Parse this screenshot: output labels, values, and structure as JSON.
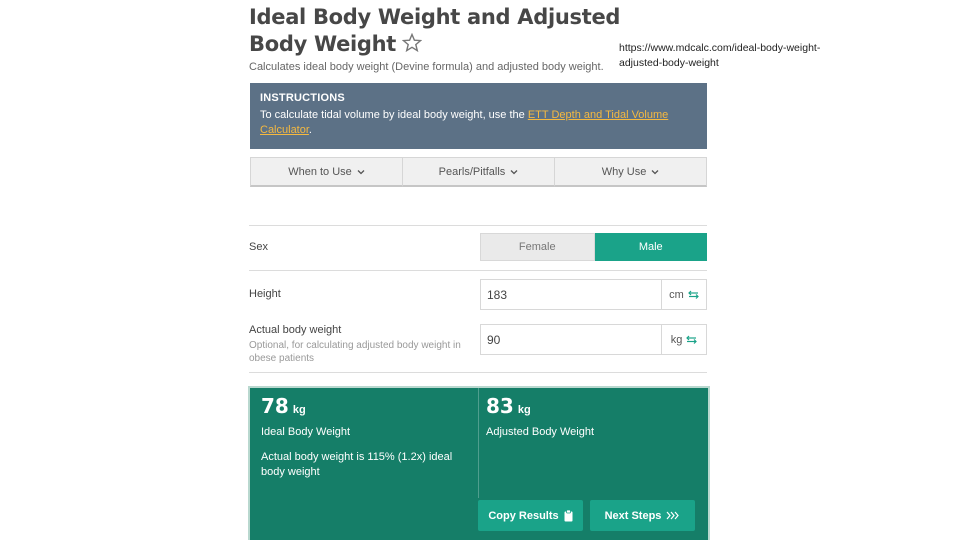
{
  "page": {
    "title": "Ideal Body Weight and Adjusted Body Weight",
    "subtitle": "Calculates ideal body weight (Devine formula) and adjusted body weight.",
    "source_url": "https://www.mdcalc.com/ideal-body-weight-adjusted-body-weight"
  },
  "instructions": {
    "heading": "INSTRUCTIONS",
    "text_before": "To calculate tidal volume by ideal body weight, use the ",
    "link_text": "ETT Depth and Tidal Volume Calculator",
    "text_after": "."
  },
  "tabs": [
    {
      "label": "When to Use"
    },
    {
      "label": "Pearls/Pitfalls"
    },
    {
      "label": "Why Use"
    }
  ],
  "form": {
    "sex": {
      "label": "Sex",
      "options": [
        "Female",
        "Male"
      ],
      "selected": "Male"
    },
    "height": {
      "label": "Height",
      "value": "183",
      "unit": "cm"
    },
    "weight": {
      "label": "Actual body weight",
      "help": "Optional, for calculating adjusted body weight in obese patients",
      "value": "90",
      "unit": "kg"
    }
  },
  "results": {
    "ideal": {
      "value": "78",
      "unit": "kg",
      "label": "Ideal Body Weight",
      "note": "Actual body weight is 115% (1.2x) ideal body weight"
    },
    "adjusted": {
      "value": "83",
      "unit": "kg",
      "label": "Adjusted Body Weight"
    },
    "copy_label": "Copy Results",
    "next_label": "Next Steps"
  },
  "colors": {
    "accent": "#1aa389",
    "results_bg": "#157e68",
    "instructions_bg": "#5c7186",
    "link": "#f5b940"
  }
}
